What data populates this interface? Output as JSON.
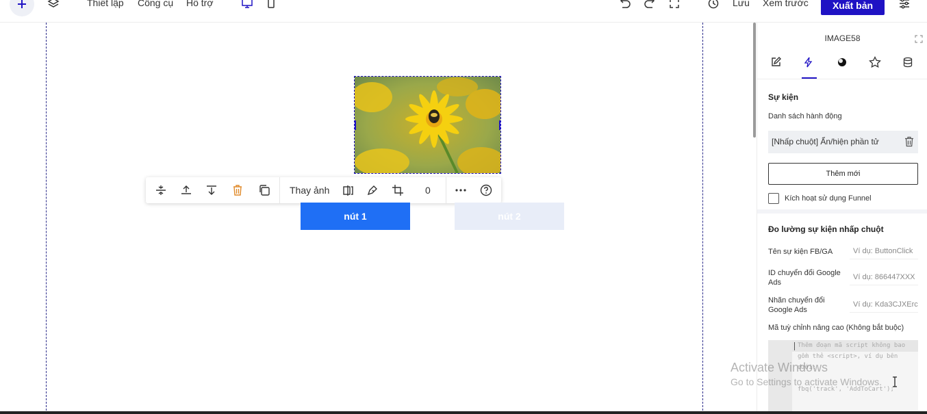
{
  "topbar": {
    "menu": [
      "Thiết lập",
      "Công cụ",
      "Hỗ trợ"
    ],
    "save_label": "Lưu",
    "preview_label": "Xem trước",
    "publish_label": "Xuất bản"
  },
  "canvas": {
    "toolbar": {
      "replace_label": "Thay ảnh",
      "rotation_value": "0"
    },
    "button1_label": "nút 1",
    "button2_label": "nút 2"
  },
  "panel": {
    "title": "IMAGE58",
    "events_title": "Sự kiện",
    "action_list_label": "Danh sách hành động",
    "action_item": "[Nhấp chuột] Ẩn/hiện phần tử",
    "add_new_label": "Thêm mới",
    "funnel_label": "Kích hoạt sử dụng Funnel",
    "measure_title": "Đo lường sự kiện nhấp chuột",
    "fields": [
      {
        "label": "Tên sự kiện FB/GA",
        "placeholder": "Ví dụ: ButtonClick"
      },
      {
        "label": "ID chuyển đổi Google Ads",
        "placeholder": "Ví dụ: 866447XXX"
      },
      {
        "label": "Nhãn chuyển đổi Google Ads",
        "placeholder": "Ví dụ: Kda3CJXErc"
      }
    ],
    "custom_code_label": "Mã tuỳ chỉnh nâng cao (Không bắt buộc)",
    "code_lines": [
      "Thêm đoạn mã script không bao",
      "gồm thẻ <script>, ví dụ bên",
      "dưới:",
      "fbq('track', 'AddToCart');"
    ]
  },
  "watermark": {
    "line1": "Activate Windows",
    "line2": "Go to Settings to activate Windows."
  },
  "colors": {
    "accent": "#1f12c4",
    "button_primary": "#1f6ff5",
    "button_secondary": "#e8edf8"
  }
}
